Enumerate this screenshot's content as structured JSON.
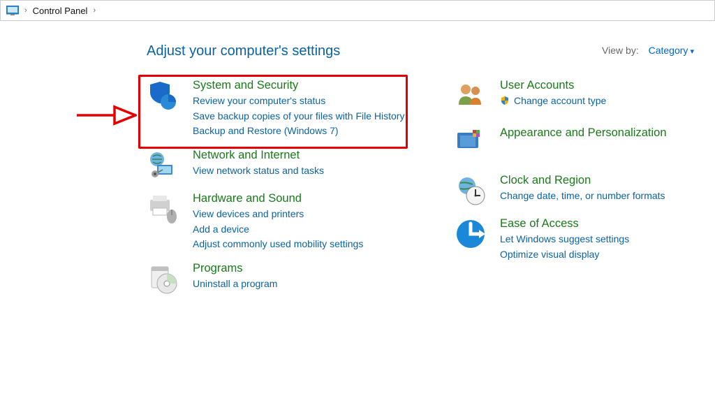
{
  "breadcrumb": {
    "root_label": "Control Panel"
  },
  "heading": "Adjust your computer's settings",
  "viewby": {
    "label": "View by:",
    "value": "Category"
  },
  "left": [
    {
      "title": "System and Security",
      "links": [
        "Review your computer's status",
        "Save backup copies of your files with File History",
        "Backup and Restore (Windows 7)"
      ]
    },
    {
      "title": "Network and Internet",
      "links": [
        "View network status and tasks"
      ]
    },
    {
      "title": "Hardware and Sound",
      "links": [
        "View devices and printers",
        "Add a device",
        "Adjust commonly used mobility settings"
      ]
    },
    {
      "title": "Programs",
      "links": [
        "Uninstall a program"
      ]
    }
  ],
  "right": [
    {
      "title": "User Accounts",
      "links": [
        "Change account type"
      ]
    },
    {
      "title": "Appearance and Personalization",
      "links": []
    },
    {
      "title": "Clock and Region",
      "links": [
        "Change date, time, or number formats"
      ]
    },
    {
      "title": "Ease of Access",
      "links": [
        "Let Windows suggest settings",
        "Optimize visual display"
      ]
    }
  ]
}
